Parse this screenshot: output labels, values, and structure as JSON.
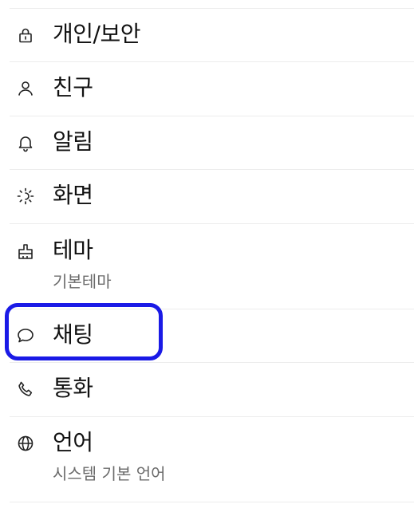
{
  "settings": {
    "items": [
      {
        "id": "privacy",
        "label": "개인/보안",
        "icon": "lock-icon"
      },
      {
        "id": "friends",
        "label": "친구",
        "icon": "person-icon"
      },
      {
        "id": "notifications",
        "label": "알림",
        "icon": "bell-icon"
      },
      {
        "id": "display",
        "label": "화면",
        "icon": "brightness-icon"
      },
      {
        "id": "theme",
        "label": "테마",
        "sublabel": "기본테마",
        "icon": "paint-brush-icon"
      },
      {
        "id": "chat",
        "label": "채팅",
        "icon": "chat-bubble-icon"
      },
      {
        "id": "call",
        "label": "통화",
        "icon": "phone-icon"
      },
      {
        "id": "language",
        "label": "언어",
        "sublabel": "시스템 기본 언어",
        "icon": "globe-icon"
      }
    ],
    "highlighted_item": "chat",
    "highlight_color": "#1a1ae6"
  }
}
